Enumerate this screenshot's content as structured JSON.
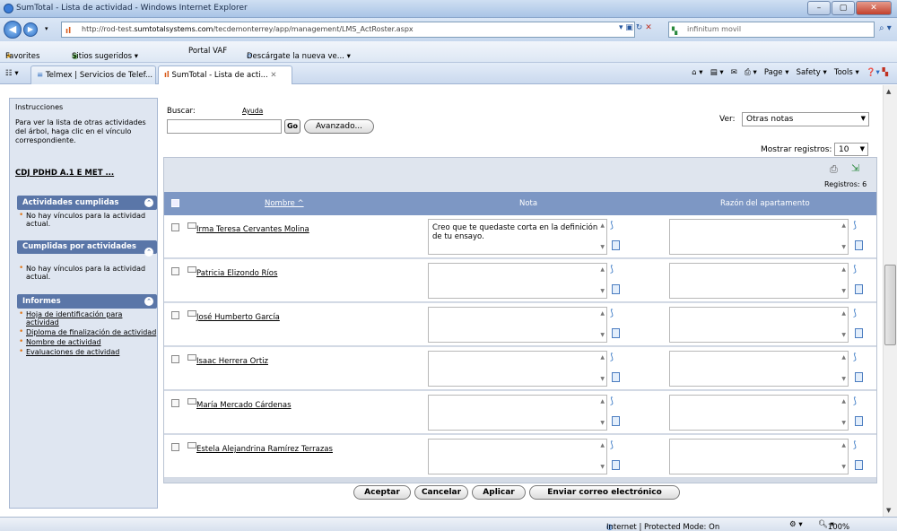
{
  "window": {
    "title": "SumTotal - Lista de actividad - Windows Internet Explorer",
    "controls": [
      "–",
      "▢",
      "✕"
    ]
  },
  "address": {
    "url_prefix": "http://rod-test.",
    "url_domain": "sumtotalsystems.com",
    "url_path": "/tecdemonterrey/app/management/LMS_ActRoster.aspx",
    "search_text": "infinitum movil"
  },
  "favorites": {
    "label": "Favorites",
    "items": [
      "Sitios sugeridos ▾",
      "Portal VAF",
      "Descárgate la nueva ve... ▾"
    ]
  },
  "tabs": [
    {
      "label": "Telmex | Servicios de Telef..."
    },
    {
      "label": "SumTotal - Lista de acti..."
    }
  ],
  "commandbar": {
    "page": "Page ▾",
    "safety": "Safety ▾",
    "tools": "Tools ▾"
  },
  "sidebar": {
    "instructions_title": "Instrucciones",
    "instructions_text": "Para ver la lista de otras actividades del árbol, haga clic en el vínculo correspondiente.",
    "activity_link": "CDJ PDHD A.1 E MET ...",
    "panels": [
      {
        "title": "Actividades cumplidas",
        "items": [
          "No hay vínculos para la actividad actual."
        ]
      },
      {
        "title": "Cumplidas por actividades",
        "items": [
          "No hay vínculos para la actividad actual."
        ]
      },
      {
        "title": "Informes",
        "items": [
          "Hoja de identificación para actividad",
          "Diploma de finalización de actividad",
          "Nombre de actividad",
          "Evaluaciones de actividad"
        ]
      }
    ]
  },
  "search": {
    "label": "Buscar:",
    "help": "Ayuda",
    "go": "Go",
    "advanced": "Avanzado..."
  },
  "view": {
    "label": "Ver:",
    "value": "Otras notas"
  },
  "records": {
    "label": "Mostrar registros:",
    "value": "10",
    "count": "Registros: 6"
  },
  "grid": {
    "columns": [
      "Nombre ^",
      "Nota",
      "Razón del apartamento"
    ],
    "rows": [
      {
        "name": "Irma Teresa Cervantes Molina",
        "note": "Creo que te quedaste corta en la definición de tu ensayo.",
        "reason": ""
      },
      {
        "name": "Patricia Elizondo Ríos",
        "note": "",
        "reason": ""
      },
      {
        "name": "José Humberto García",
        "note": "",
        "reason": ""
      },
      {
        "name": "Isaac Herrera Ortiz",
        "note": "",
        "reason": ""
      },
      {
        "name": "María Mercado Cárdenas",
        "note": "",
        "reason": ""
      },
      {
        "name": "Estela Alejandrina Ramírez Terrazas",
        "note": "",
        "reason": ""
      }
    ]
  },
  "actions": {
    "accept": "Aceptar",
    "cancel": "Cancelar",
    "apply": "Aplicar",
    "email": "Enviar correo electrónico"
  },
  "status": {
    "zone": "Internet | Protected Mode: On",
    "zoom": "100%"
  },
  "colors": {
    "header_blue": "#7d97c4",
    "panel_blue": "#5a76a8",
    "sidebar_bg": "#dfe6f1",
    "bullet_orange": "#e07a1f"
  }
}
